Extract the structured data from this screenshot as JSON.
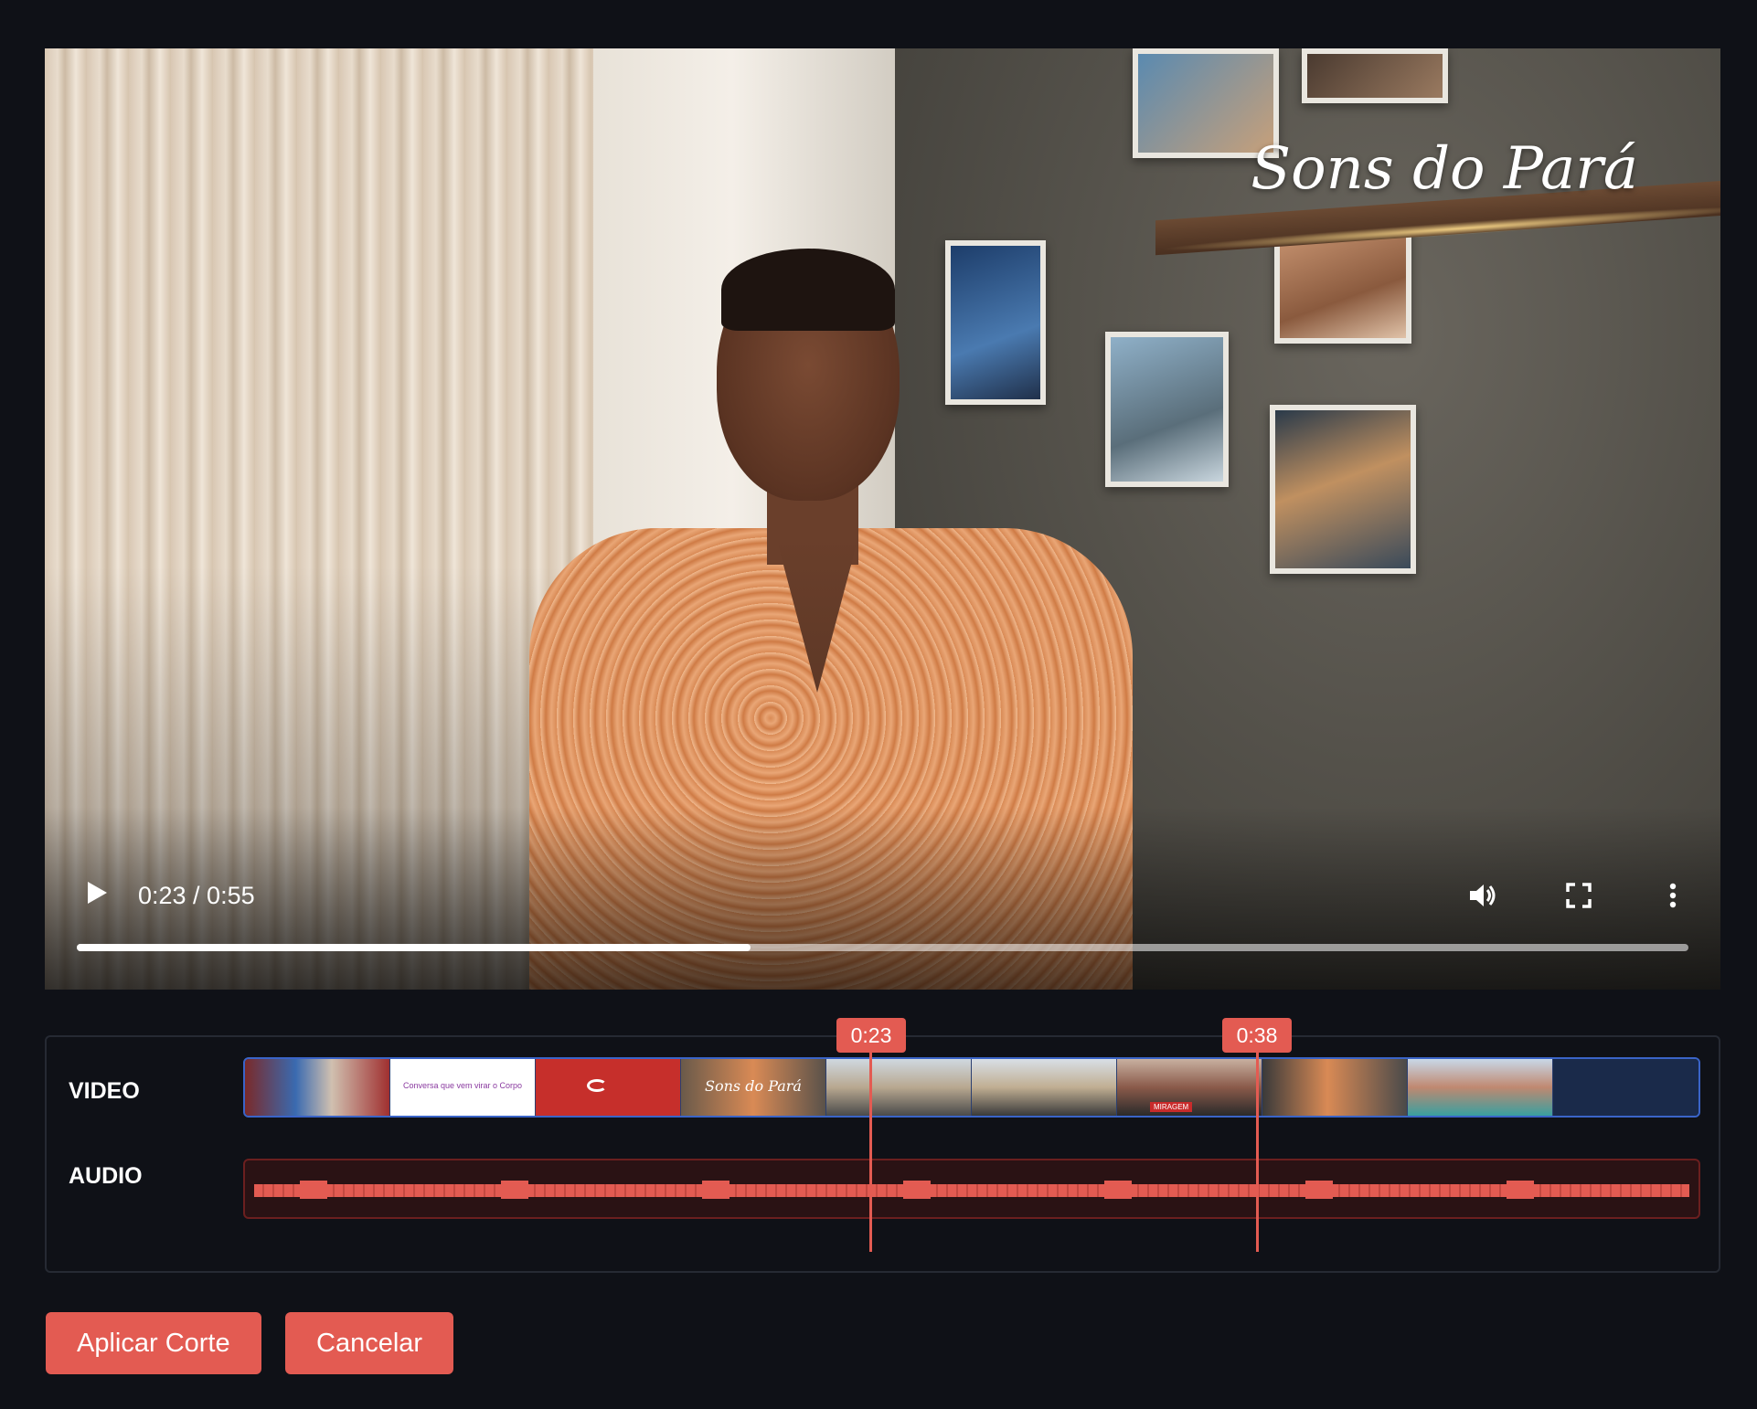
{
  "player": {
    "watermark": "Sons do Pará",
    "time_display": "0:23 / 0:55",
    "progress": 0.4182,
    "icons": {
      "play": "play-icon",
      "volume": "volume-icon",
      "fullscreen": "fullscreen-icon",
      "more": "more-vertical-icon"
    }
  },
  "timeline": {
    "video_label": "VIDEO",
    "audio_label": "AUDIO",
    "start_marker": "0:23",
    "end_marker": "0:38",
    "thumbnails": [
      {
        "kind": "news",
        "text": ""
      },
      {
        "kind": "white-title",
        "text": "Conversa que vem virar o Corpo"
      },
      {
        "kind": "red-logo",
        "text": ""
      },
      {
        "kind": "script",
        "text": "Sons do Pará"
      },
      {
        "kind": "band",
        "text": ""
      },
      {
        "kind": "band",
        "text": ""
      },
      {
        "kind": "band-tag",
        "text": "MIRAGEM"
      },
      {
        "kind": "person",
        "text": ""
      },
      {
        "kind": "couple",
        "text": ""
      },
      {
        "kind": "empty",
        "text": ""
      }
    ]
  },
  "actions": {
    "apply_label": "Aplicar Corte",
    "cancel_label": "Cancelar"
  },
  "colors": {
    "accent": "#e35b52",
    "background": "#0f1117",
    "video_track_border": "#3a64c8",
    "audio_track_bg": "#2a1214"
  }
}
